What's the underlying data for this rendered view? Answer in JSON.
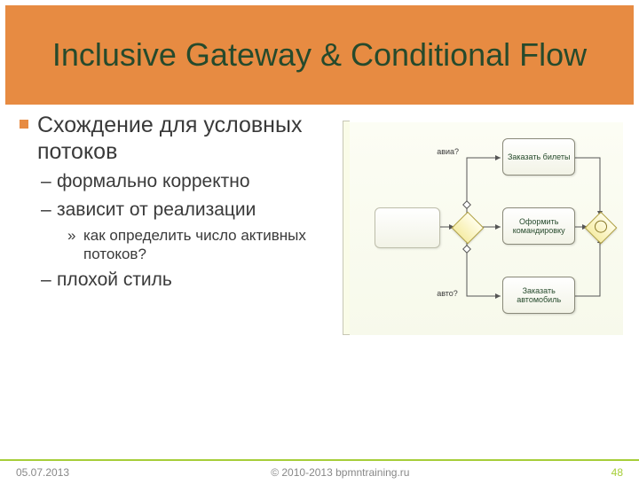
{
  "title": "Inclusive Gateway & Conditional Flow",
  "bullets": {
    "l1": "Схождение для условных потоков",
    "l2_1": "формально корректно",
    "l2_2": "зависит от реализации",
    "l3_1": "как определить число активных потоков?",
    "l2_3": "плохой стиль"
  },
  "diagram": {
    "task_top": "Заказать билеты",
    "task_mid": "Оформить командировку",
    "task_bot": "Заказать автомобиль",
    "label_top": "авиа?",
    "label_bot": "авто?"
  },
  "footer": {
    "date": "05.07.2013",
    "copyright": "© 2010-2013 bpmntraining.ru",
    "page": "48"
  }
}
